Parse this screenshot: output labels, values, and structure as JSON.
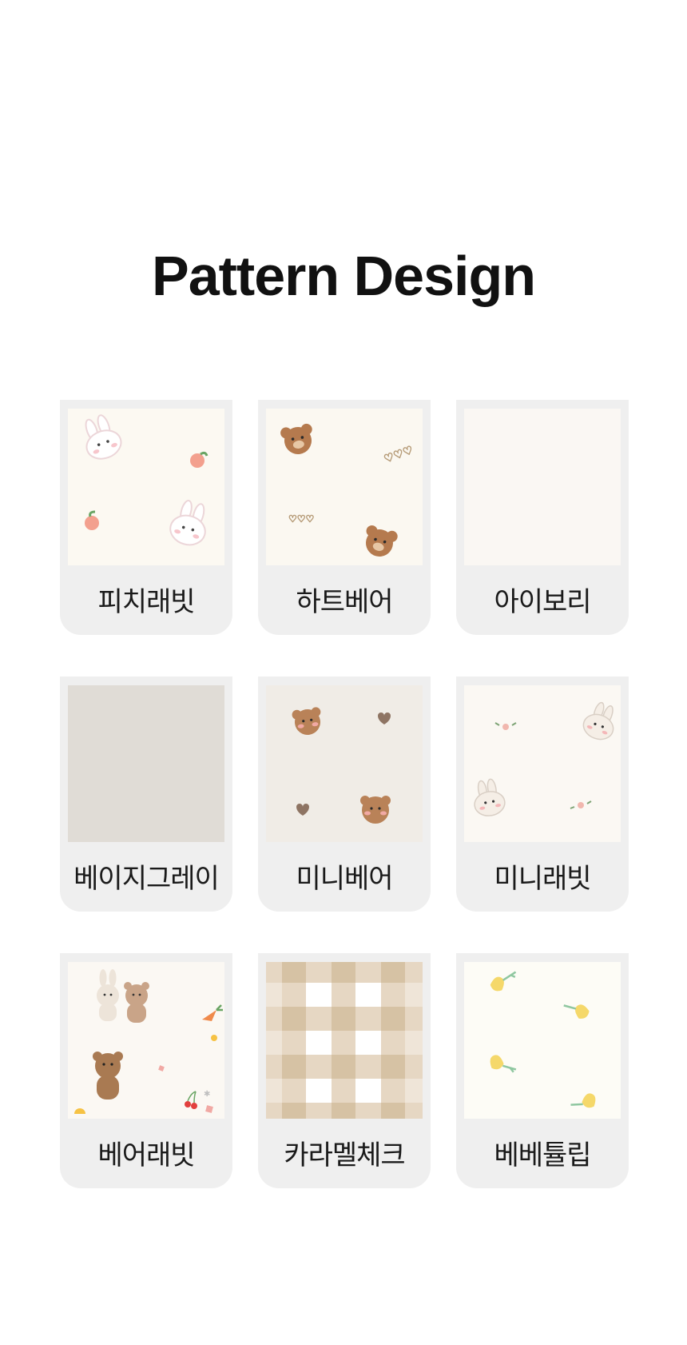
{
  "page": {
    "title": "Pattern Design"
  },
  "patterns": [
    {
      "label": "피치래빗",
      "bg": "#fcf9f2",
      "motif": "bunny-peach-pattern"
    },
    {
      "label": "하트베어",
      "bg": "#fbf8f1",
      "motif": "bear-heart-pattern"
    },
    {
      "label": "아이보리",
      "bg": "#faf7f3",
      "motif": "solid-ivory"
    },
    {
      "label": "베이지그레이",
      "bg": "#e0dcd6",
      "motif": "solid-beige-gray"
    },
    {
      "label": "미니베어",
      "bg": "#f0ece6",
      "motif": "mini-bear-pattern"
    },
    {
      "label": "미니래빗",
      "bg": "#fbf8f3",
      "motif": "mini-rabbit-pattern"
    },
    {
      "label": "베어래빗",
      "bg": "#fbf8f3",
      "motif": "bear-rabbit-pattern"
    },
    {
      "label": "카라멜체크",
      "bg": "#ffffff",
      "motif": "caramel-check-pattern"
    },
    {
      "label": "베베튤립",
      "bg": "#fdfcf6",
      "motif": "tulip-pattern"
    }
  ],
  "colors": {
    "card_bg": "#efefef",
    "title": "#111111",
    "label": "#1a1a1a"
  }
}
